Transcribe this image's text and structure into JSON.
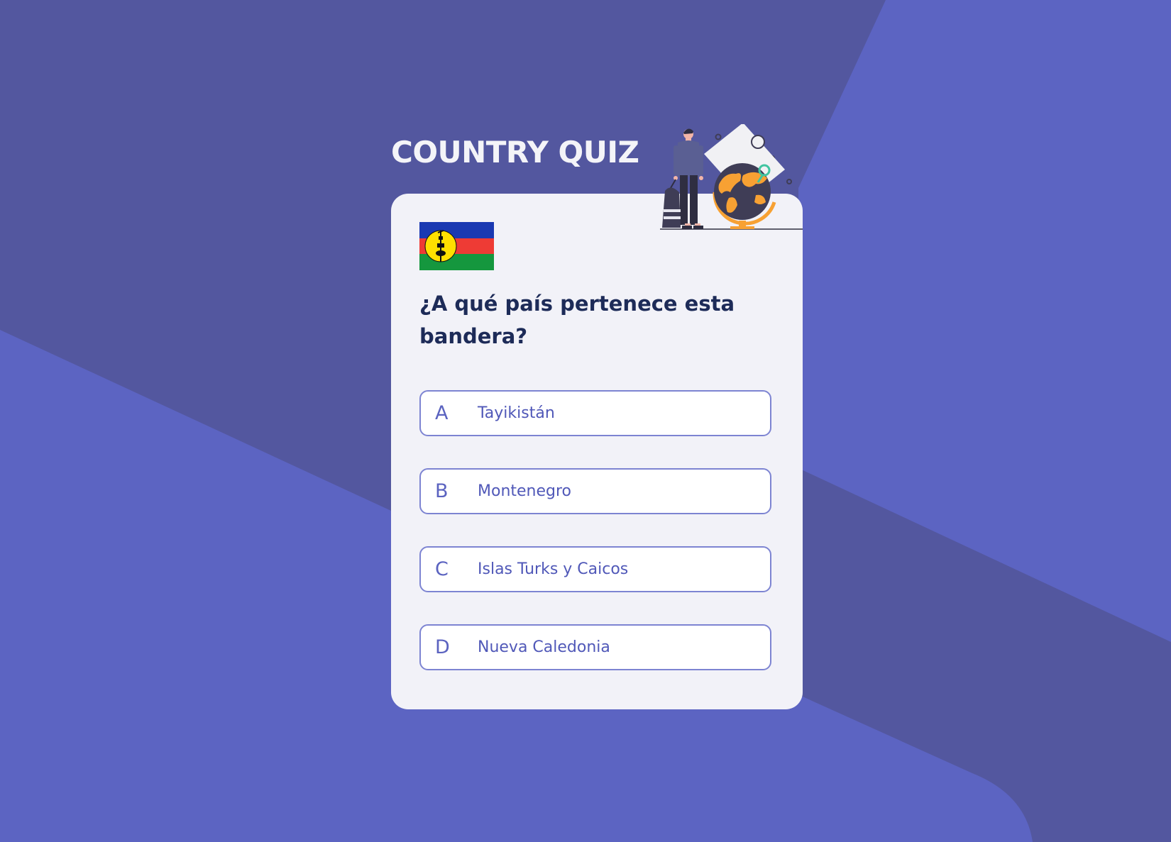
{
  "app": {
    "title": "COUNTRY QUIZ"
  },
  "colors": {
    "background": "#5c64c2",
    "background_dark_band": "#53579f",
    "card": "#f2f2f8",
    "question_text": "#1d2b58",
    "option_border": "#7d84d2",
    "option_text": "#5058b8",
    "accent_orange": "#f7a133"
  },
  "flag": {
    "icon": "new-caledonia-flag",
    "colors": [
      "#1a39b2",
      "#ee3b35",
      "#15973e",
      "#ffe000"
    ]
  },
  "question": {
    "text": "¿A qué país pertenece esta bandera?"
  },
  "options": [
    {
      "letter": "A",
      "label": "Tayikistán"
    },
    {
      "letter": "B",
      "label": "Montenegro"
    },
    {
      "letter": "C",
      "label": "Islas Turks y Caicos"
    },
    {
      "letter": "D",
      "label": "Nueva Caledonia"
    }
  ],
  "illustration": {
    "icon": "traveler-with-globe-icon"
  }
}
